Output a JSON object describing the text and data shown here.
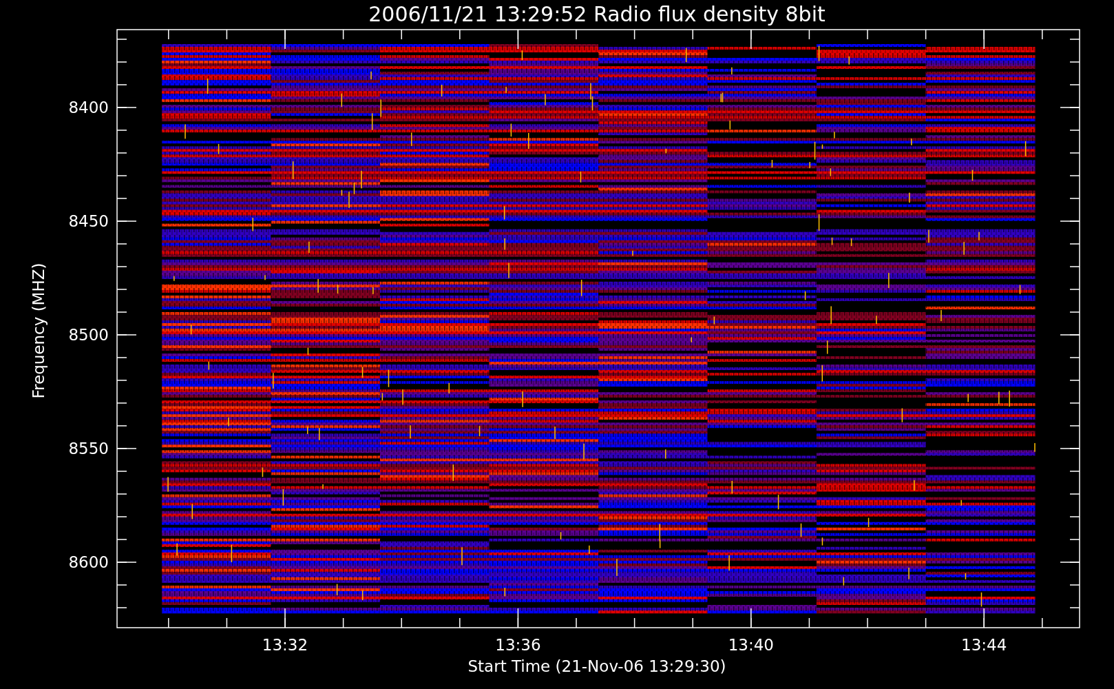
{
  "title": "2006/11/21 13:29:52 Radio flux density 8bit",
  "y_axis": {
    "label": "Frequency (MHZ)",
    "ticks": [
      "8400",
      "8450",
      "8500",
      "8550",
      "8600"
    ]
  },
  "x_axis": {
    "label": "Start Time (21-Nov-06 13:29:30)",
    "ticks": [
      "13:32",
      "13:36",
      "13:40",
      "13:44"
    ]
  }
}
